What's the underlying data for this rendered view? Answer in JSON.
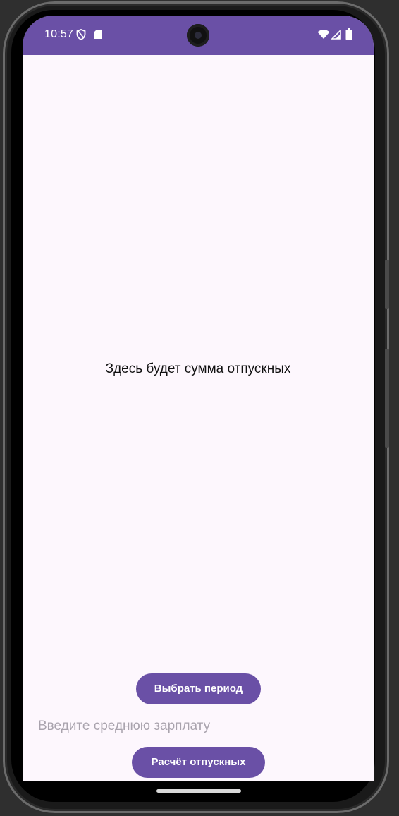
{
  "status_bar": {
    "time": "10:57",
    "left_icons": [
      "shield-icon",
      "sd-card-icon"
    ],
    "right_icons": [
      "wifi-icon",
      "signal-icon",
      "battery-icon"
    ],
    "color": "#6a50a6"
  },
  "main": {
    "result_text": "Здесь будет сумма отпускных",
    "select_period_label": "Выбрать период",
    "salary_placeholder": "Введите среднюю зарплату",
    "salary_value": "",
    "calculate_label": "Расчёт отпускных"
  },
  "colors": {
    "accent": "#6a50a6",
    "background": "#fdf7fd"
  }
}
